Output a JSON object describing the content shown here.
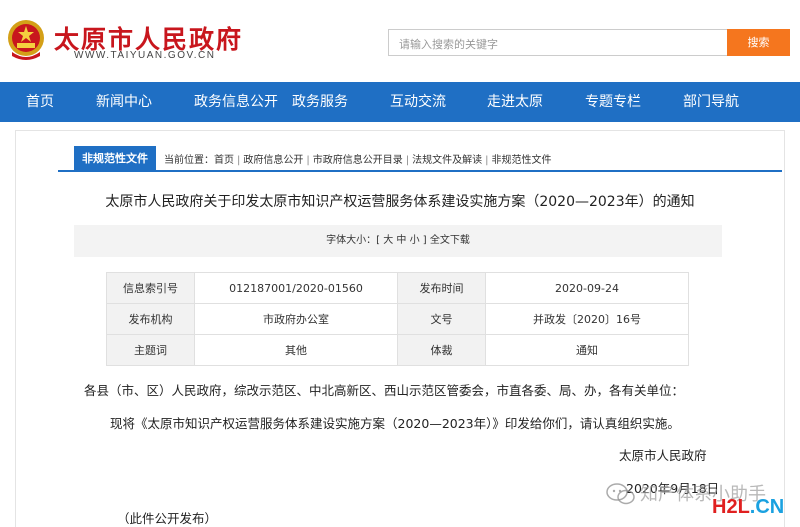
{
  "header": {
    "site_name": "太原市人民政府",
    "site_url": "WWW.TAIYUAN.GOV.CN",
    "search_placeholder": "请输入搜索的关键字",
    "search_button": "搜索"
  },
  "nav": {
    "items": [
      {
        "label": "首页"
      },
      {
        "label": "新闻中心"
      },
      {
        "label": "政务信息公开"
      },
      {
        "label": "政务服务"
      },
      {
        "label": "互动交流"
      },
      {
        "label": "走进太原"
      },
      {
        "label": "专题专栏"
      },
      {
        "label": "部门导航"
      }
    ]
  },
  "tab": {
    "label": "非规范性文件"
  },
  "breadcrumb": {
    "prefix": "当前位置：",
    "items": [
      "首页",
      "政府信息公开",
      "市政府信息公开目录",
      "法规文件及解读",
      "非规范性文件"
    ],
    "separator": "|"
  },
  "document": {
    "title": "太原市人民政府关于印发太原市知识产权运营服务体系建设实施方案（2020—2023年）的通知",
    "font_size_label": "字体大小：",
    "font_large": "大",
    "font_medium": "中",
    "font_small": "小",
    "bracket_open": "[",
    "bracket_close": "]",
    "download": "全文下载"
  },
  "meta": {
    "rows": [
      {
        "k1": "信息索引号",
        "v1": "012187001/2020-01560",
        "k2": "发布时间",
        "v2": "2020-09-24"
      },
      {
        "k1": "发布机构",
        "v1": "市政府办公室",
        "k2": "文号",
        "v2": "并政发〔2020〕16号"
      },
      {
        "k1": "主题词",
        "v1": "其他",
        "k2": "体裁",
        "v2": "通知"
      }
    ]
  },
  "body": {
    "p1": "各县（市、区）人民政府，综改示范区、中北高新区、西山示范区管委会，市直各委、局、办，各有关单位：",
    "p2": "现将《太原市知识产权运营服务体系建设实施方案（2020—2023年）》印发给你们，请认真组织实施。",
    "signer": "太原市人民政府",
    "date": "2020年9月18日",
    "note": "（此件公开发布）"
  },
  "watermark": {
    "text": "知产体系小助手",
    "logo_h": "H2L",
    "logo_d": ".CN"
  },
  "colors": {
    "brand_red": "#c8161d",
    "nav_blue": "#1f6fc4",
    "search_orange": "#f5761e"
  }
}
